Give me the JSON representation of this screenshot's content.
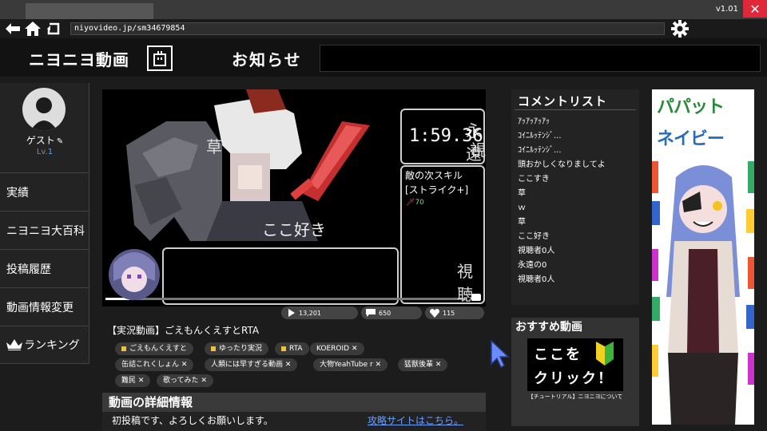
{
  "window": {
    "version": "v1.01"
  },
  "browser": {
    "url": "niyovideo.jp/sm34679854"
  },
  "header": {
    "site_title": "ニヨニヨ動画",
    "news_label": "お知らせ"
  },
  "user": {
    "name": "ゲスト",
    "level_prefix": "Lv.",
    "level": "1"
  },
  "sidebar": {
    "items": [
      {
        "label": "実績"
      },
      {
        "label": "ニヨニヨ大百科"
      },
      {
        "label": "投稿履歴"
      },
      {
        "label": "動画情報変更"
      },
      {
        "label": "ランキング"
      }
    ]
  },
  "player": {
    "timer": "1:59.36",
    "skill_label": "敵の次スキル",
    "skill_name": "[ストライク+]",
    "skill_value": "70",
    "overlay_comments": [
      "草",
      "ここ好き",
      "永遠",
      "視",
      "視聴"
    ],
    "stats": {
      "views": "13,201",
      "comments": "650",
      "likes": "115"
    }
  },
  "video": {
    "title": "【実況動画】ごえもんくえすとRTA",
    "tags": [
      {
        "label": "ごえもんくえすと",
        "locked": true
      },
      {
        "label": "ゆったり実況",
        "locked": true
      },
      {
        "label": "RTA",
        "locked": true
      },
      {
        "label": "KOEROID",
        "locked": false
      },
      {
        "label": "缶詰これくしょん",
        "locked": false
      },
      {
        "label": "人類には早すぎる動画",
        "locked": false
      },
      {
        "label": "大物YeahTube r",
        "locked": false
      },
      {
        "label": "猛獣後輩",
        "locked": false
      },
      {
        "label": "難民",
        "locked": false
      },
      {
        "label": "歌ってみた",
        "locked": false
      }
    ],
    "details_title": "動画の詳細情報",
    "description": "初投稿です、よろしくお願いします。",
    "guide_link": "攻略サイトはこちら。"
  },
  "comments": {
    "title": "コメントリスト",
    "items": [
      "ｱｯｱｯｱｯｱｯ",
      "ｺｲﾆﾙｯﾃﾝｼﾞ...",
      "ｺｲﾆﾙｯﾃﾝｼﾞ...",
      "頭おかしくなりましてよ",
      "ここすき",
      "草",
      "ｗ",
      "草",
      "ここ好き",
      "視聴者0人",
      "永遠の0",
      "視聴者0人"
    ]
  },
  "recommend": {
    "title": "おすすめ動画",
    "thumb_line1": "ここを",
    "thumb_line2": "クリック！",
    "caption": "【チュートリアル】ニヨニヨについて"
  },
  "ad": {
    "line1": "パパット",
    "line2": "ネイビー"
  },
  "colors": {
    "close": "#e0283a",
    "link": "#6aa0ff",
    "tag_lock": "#f0c040",
    "beginner_green": "#3cb43c",
    "beginner_yellow": "#f0d020"
  }
}
